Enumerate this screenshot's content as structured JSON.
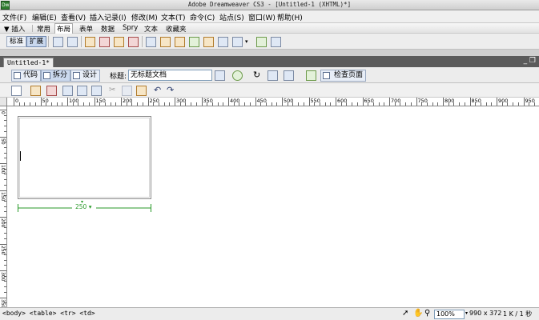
{
  "window": {
    "title": "Adobe Dreamweaver CS3 - [Untitled-1 (XHTML)*]",
    "app_icon": "Dw"
  },
  "menu": [
    "文件(F)",
    "编辑(E)",
    "查看(V)",
    "插入记录(I)",
    "修改(M)",
    "文本(T)",
    "命令(C)",
    "站点(S)",
    "窗口(W)",
    "帮助(H)"
  ],
  "insert_bar": {
    "collapse_label": "▼ 插入",
    "tabs": [
      "常用",
      "布局",
      "表单",
      "数据",
      "Spry",
      "文本",
      "收藏夹"
    ],
    "active_tab": "布局"
  },
  "layout_toolbar": {
    "mode_standard": "标准",
    "mode_expanded": "扩展",
    "active_mode": "扩展"
  },
  "document": {
    "tab_label": "Untitled-1*",
    "view_code": "代码",
    "view_split": "拆分",
    "view_design": "设计",
    "title_label": "标题:",
    "title_value": "无标题文档",
    "preview_label": "检查页面"
  },
  "ruler": {
    "h_ticks": [
      "0",
      "50",
      "100",
      "150",
      "200",
      "250",
      "300",
      "350",
      "400",
      "450",
      "500",
      "550",
      "600",
      "650",
      "700",
      "750",
      "800",
      "850",
      "900",
      "950"
    ],
    "v_ticks": [
      "0",
      "50",
      "100",
      "150",
      "200",
      "250",
      "300",
      "350"
    ]
  },
  "table_width_indicator": "250 ▾",
  "status": {
    "tag_selector": "<body> <table> <tr> <td>",
    "zoom": "100%",
    "window_size": "990 x 372",
    "file_size": "1 K / 1 秒"
  },
  "colors": {
    "highlight_circle": "#e2001a",
    "width_indicator": "#2a9a2a"
  }
}
